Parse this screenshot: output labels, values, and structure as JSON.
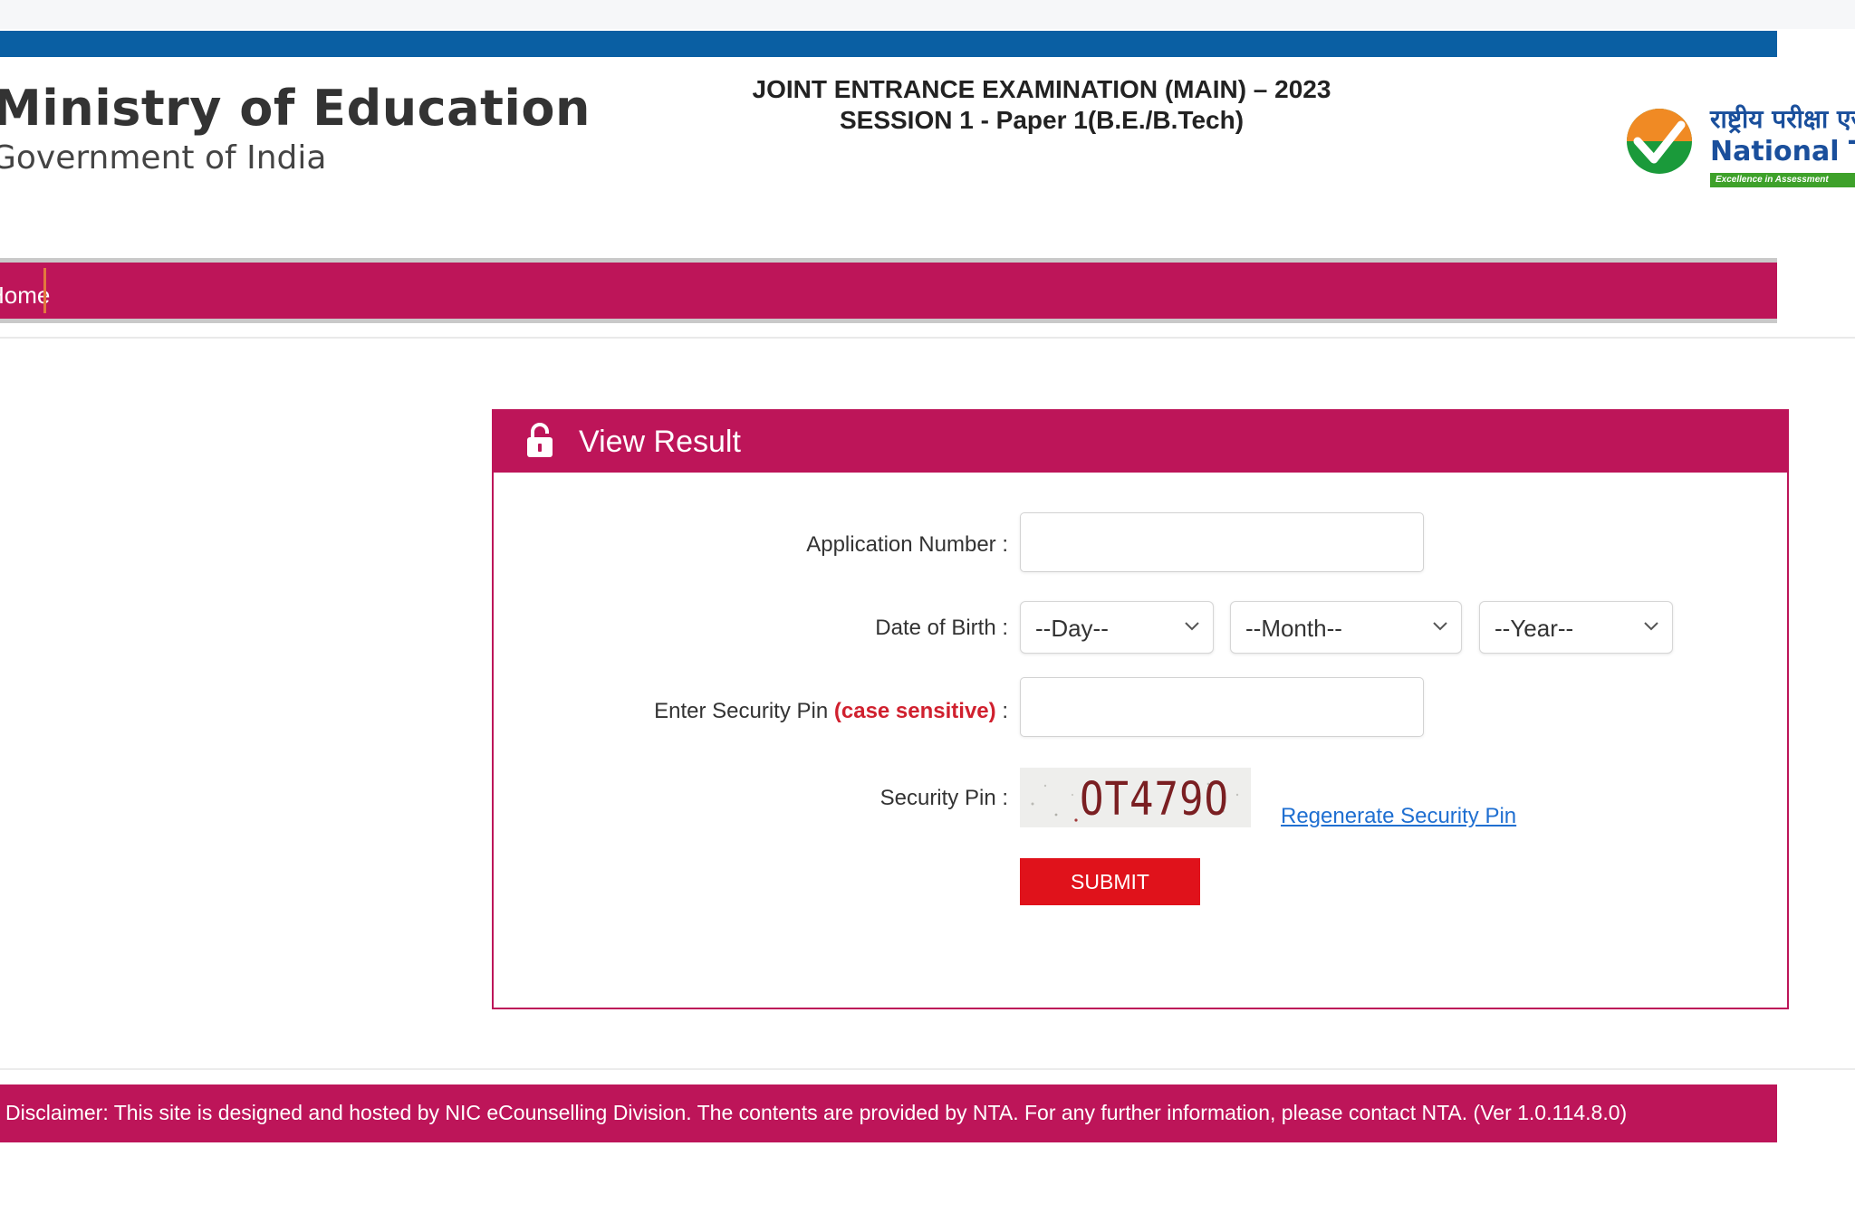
{
  "header": {
    "ministry_title": "Ministry of Education",
    "ministry_subtitle": "Government of India",
    "exam_line1": "JOINT ENTRANCE EXAMINATION (MAIN) – 2023",
    "exam_line2": "SESSION 1 - Paper 1(B.E./B.Tech)",
    "nta_hindi": "राष्ट्रीय परीक्षा एजेंसी",
    "nta_english": "National Testing Agency",
    "nta_tagline": "Excellence in Assessment"
  },
  "nav": {
    "home_label": "Home"
  },
  "panel": {
    "title": "View Result",
    "lock_icon": "lock-icon"
  },
  "form": {
    "application_number_label": "Application Number :",
    "application_number_value": "",
    "dob_label": "Date of Birth :",
    "day_selected": "--Day--",
    "month_selected": "--Month--",
    "year_selected": "--Year--",
    "security_pin_input_label": "Enter Security Pin",
    "security_pin_input_accent": "(case sensitive)",
    "security_pin_input_suffix": " :",
    "security_pin_value": "",
    "security_pin_label": "Security Pin :",
    "captcha_text": "OT479O",
    "regenerate_label": "Regenerate Security Pin",
    "submit_label": "SUBMIT"
  },
  "footer": {
    "disclaimer": "Disclaimer: This site is designed and hosted by NIC eCounselling Division. The contents are provided by NTA. For any further information, please contact NTA. (Ver 1.0.114.8.0)"
  },
  "colors": {
    "brand_blue": "#0a5fa3",
    "brand_magenta": "#bd1559",
    "submit_red": "#e0121b",
    "link_blue": "#1f6fd1",
    "accent_red": "#d0202e"
  }
}
